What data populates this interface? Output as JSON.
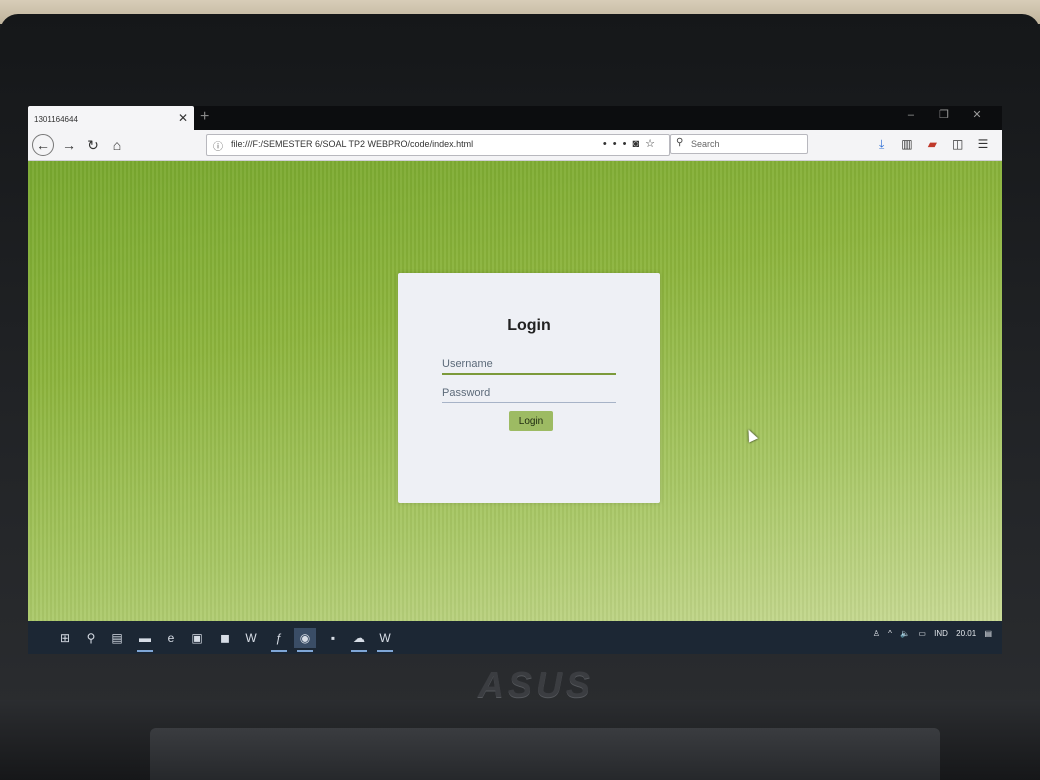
{
  "browser": {
    "tab_title": "1301164644",
    "url": "file:///F:/SEMESTER 6/SOAL TP2 WEBPRO/code/index.html",
    "search_placeholder": "Search"
  },
  "login": {
    "title": "Login",
    "username_placeholder": "Username",
    "password_placeholder": "Password",
    "button_label": "Login"
  },
  "taskbar": {
    "language": "IND",
    "time": "20.01"
  },
  "laptop": {
    "brand": "ASUS"
  },
  "colors": {
    "page_bg_start": "#78a82e",
    "page_bg_end": "#c8da94",
    "card_bg": "#eef0f5",
    "button_bg": "#9dbb63"
  }
}
